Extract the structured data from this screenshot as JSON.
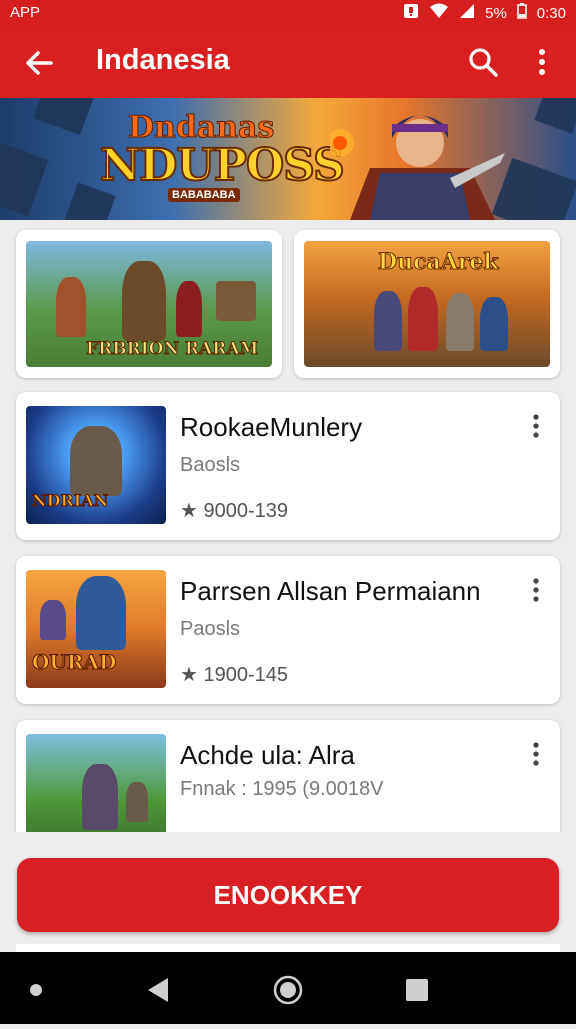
{
  "status_bar": {
    "left": "APP",
    "battery_text": "5%",
    "time": "0:30"
  },
  "app_bar": {
    "title": "Indanesia"
  },
  "banner": {
    "logo_line1": "Dndanas",
    "logo_line2": "NDUPOSS",
    "logo_tag": "BABABABA"
  },
  "featured": [
    {
      "art_title": "FRBRION RARAM"
    },
    {
      "art_title": "DucaArek"
    }
  ],
  "list": [
    {
      "name": "RookaeMunlery",
      "category": "Baosls",
      "rating_text": "★ 9000-139",
      "thumb_text": "NDRIAN"
    },
    {
      "name": "Parrsen Allsan Permaiann",
      "category": "Paosls",
      "rating_text": "★ 1900-145",
      "thumb_text": "OURAD"
    },
    {
      "name": "Achde ula: Alra",
      "category": "Fnnak : 1995 (9.0018V",
      "rating_text": "",
      "thumb_text": ""
    }
  ],
  "primary_button": {
    "label": "ENOOKKEY"
  },
  "colors": {
    "brand_red": "#d91f1f",
    "button_red": "#d71f24",
    "navbar": "#000000"
  }
}
